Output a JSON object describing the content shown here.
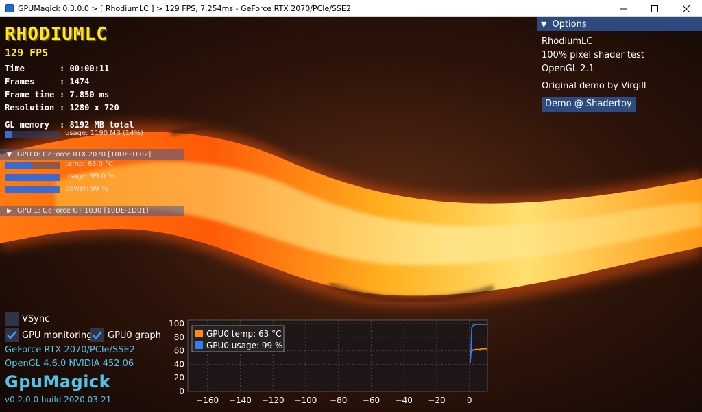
{
  "window": {
    "title": "GPUMagick 0.3.0.0 > [ RhodiumLC ] > 129 FPS, 7.254ms - GeForce RTX 2070/PCIe/SSE2"
  },
  "hud": {
    "demo_name": "RHODIUMLC",
    "fps": "129 FPS",
    "stats": [
      {
        "label": "Time",
        "value": "00:00:11"
      },
      {
        "label": "Frames",
        "value": "1474"
      },
      {
        "label": "Frame time",
        "value": "7.850 ms"
      },
      {
        "label": "Resolution",
        "value": "1280 x 720"
      }
    ],
    "gl_memory": {
      "label": "GL memory",
      "value": "8192 MB total",
      "usage_text": "usage: 1190 MB (14%)",
      "usage_fraction": 0.14
    },
    "gpu0": {
      "header": "GPU 0: GeForce RTX 2070 [10DE-1F02]",
      "temp_text": "temp: 63.0 °C",
      "temp_fraction": 0.5,
      "usage_text": "usage: 99.0 %",
      "usage_fraction": 0.99,
      "power_text": "power: 99 %",
      "power_fraction": 0.99
    },
    "gpu1": {
      "header": "GPU 1: GeForce GT 1030 [10DE-1D01]"
    }
  },
  "options": {
    "header": "Options",
    "lines": [
      "RhodiumLC",
      "100% pixel shader test",
      "OpenGL 2.1"
    ],
    "credit": "Original demo by Virgill",
    "button": "Demo @ Shadertoy"
  },
  "controls": {
    "vsync": {
      "label": "VSync",
      "checked": false
    },
    "gpu_monitoring": {
      "label": "GPU monitoring",
      "checked": true
    },
    "gpu0_graph": {
      "label": "GPU0 graph",
      "checked": true
    }
  },
  "info": {
    "renderer": "GeForce RTX 2070/PCIe/SSE2",
    "opengl": "OpenGL 4.6.0 NVIDIA 452.06",
    "brand": "GpuMagick",
    "version": "v0.2.0.0 build 2020.03-21"
  },
  "chart_data": {
    "type": "line",
    "x_ticks": [
      -160,
      -140,
      -120,
      -100,
      -80,
      -60,
      -40,
      -20,
      0
    ],
    "y_ticks": [
      0,
      20,
      40,
      60,
      80,
      100
    ],
    "xlim": [
      -172,
      11
    ],
    "ylim": [
      0,
      105
    ],
    "grid": true,
    "legend_placement": "top-left",
    "series": [
      {
        "name": "GPU0 temp: 63 °C",
        "color": "#ff8c1a",
        "x": [
          0.5,
          1,
          2,
          4,
          6,
          8,
          10,
          11
        ],
        "y": [
          45,
          60,
          61,
          62,
          62,
          63,
          63,
          63
        ]
      },
      {
        "name": "GPU0 usage: 99 %",
        "color": "#2e7ff0",
        "x": [
          0.5,
          1,
          1.5,
          2,
          4,
          6,
          8,
          10,
          11
        ],
        "y": [
          42,
          60,
          94,
          97,
          99,
          99,
          99,
          99,
          99
        ]
      }
    ]
  },
  "colors": {
    "accent_yellow": "#ffe81a",
    "accent_cyan": "#4fc3e8",
    "panel_blue": "#2d4b7e",
    "bar_blue": "#3a6bd4"
  }
}
